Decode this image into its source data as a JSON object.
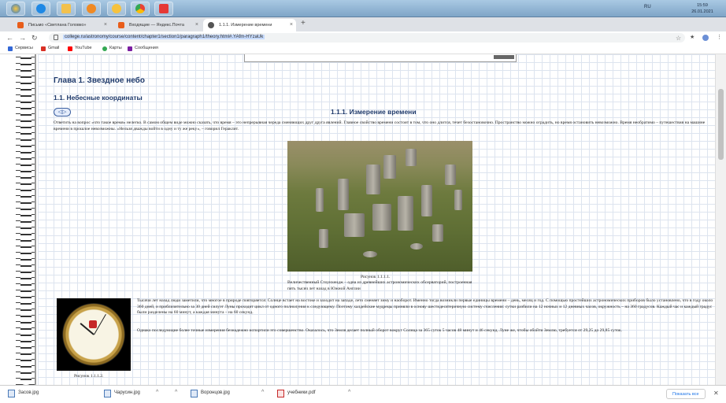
{
  "taskbar": {
    "icons": [
      "windows-start",
      "internet-explorer",
      "file-explorer",
      "media-player",
      "yandex-browser",
      "chrome",
      "paint"
    ],
    "language": "RU",
    "clock_time": "15:59",
    "clock_date": "26.01.2021"
  },
  "tabs": [
    {
      "label": "Письмо «Светлана Головко»",
      "favicon_color": "#e85d1a"
    },
    {
      "label": "Входящие — Яндекс.Почта",
      "favicon_color": "#e85d1a"
    },
    {
      "label": "1.1.1. Измерение времени",
      "favicon_color": "#555555"
    }
  ],
  "new_tab_label": "+",
  "address_bar": {
    "url": "college.ru/astronomy/course/content/chapter1/section1/paragraph1/theory.html#.YAfm-HYzaUk"
  },
  "bookmarks": [
    {
      "label": "Сервисы",
      "color": "#3367d6"
    },
    {
      "label": "Gmail",
      "color": "#d93025"
    },
    {
      "label": "YouTube",
      "color": "#ff0000"
    },
    {
      "label": "Карты",
      "color": "#34a853"
    },
    {
      "label": "Сообщения",
      "color": "#7b1fa2"
    }
  ],
  "page": {
    "chapter_title": "Глава 1. Звездное небо",
    "section_title": "1.1. Небесные координаты",
    "pager_label": "◁▷",
    "topic_title": "1.1.1. Измерение времени",
    "para1": "Ответить на вопрос «что такое время» нелегко. В самом общем виде можно сказать, что время – это непрерывная череда сменяющих друг друга явлений. Главное свойство времени состоит в том, что оно длится, течет безостановочно. Пространство можно оградить, но время остановить невозможно. Время необратимо – путешествия на машине времени в прошлое невозможны. «Нельзя дважды войти в одну и ту же реку», – говорил Гераклит.",
    "fig1_label": "Рисунок 1.1.1.1.",
    "fig1_caption": "Величественный Стоунхендж – одна из древнейших астрономических обсерваторий, построенная пять тысяч лет назад в Южной Англии",
    "para2": "Тысячи лет назад люди заметили, что многое в природе повторяется: Солнце встает на востоке и заходит на западе, лето сменяет зиму и наоборот. Именно тогда возникли первые единицы времени – день, месяц и год. С помощью простейших астрономических приборов было установлено, что в году около 360 дней, и приблизительно за 30 дней силуэт Луны проходит цикл от одного полнолуния к следующему. Поэтому халдейские мудрецы приняли в основу шестидесятеричную систему счисления: сутки разбили на 12 ночных и 12 дневных часов, окружность – на 360 градусов. Каждый час и каждый градус были разделены на 60 минут, а каждая минута – на 60 секунд.",
    "para3": "Однако последующие более точные измерения безнадежно испортили это совершенство. Оказалось, что Земля делает полный оборот вокруг Солнца за 365 суток 5 часов 48 минут и 46 секунд. Луне же, чтобы обойти Землю, требуется от 29,25 до 29,85 суток.",
    "fig2_label": "Рисунок 1.1.1.2."
  },
  "downloads": [
    {
      "label": "Засов.jpg"
    },
    {
      "label": "Чарусин.jpg"
    },
    {
      "label": "Воронцов.jpg"
    },
    {
      "label": "учебники.pdf"
    }
  ],
  "show_all_label": "Показать все",
  "close_label": "✕"
}
